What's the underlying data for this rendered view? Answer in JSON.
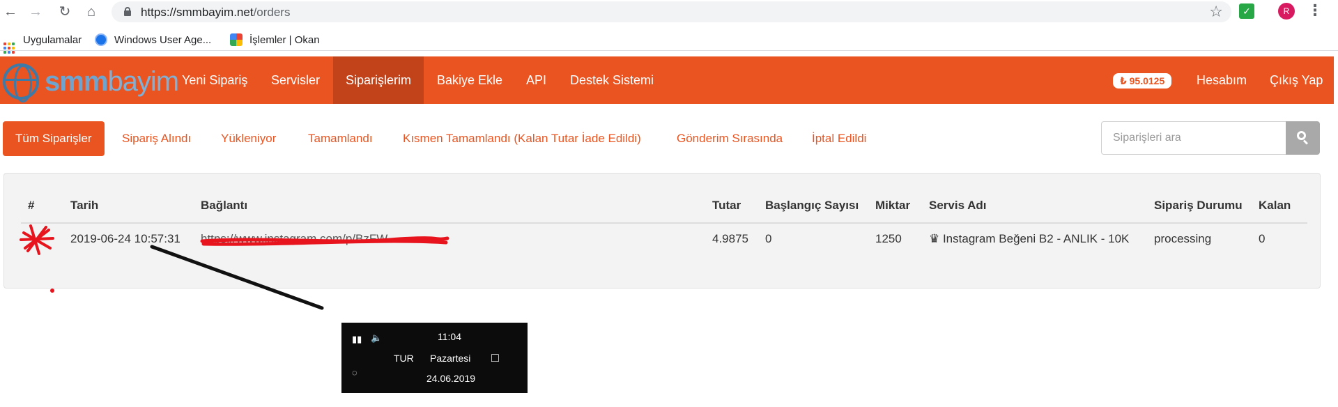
{
  "browser": {
    "url_host": "https://smmbayim.net",
    "url_path": "/orders",
    "profile_initial": "R",
    "icons": [
      "back-arrow-icon",
      "forward-arrow-icon",
      "reload-icon",
      "home-icon",
      "lock-icon",
      "star-icon",
      "extension-icon",
      "profile-icon",
      "menu-icon"
    ]
  },
  "bookmarks": [
    {
      "label": "Uygulamalar"
    },
    {
      "label": "Windows User Age..."
    },
    {
      "label": "İşlemler | Okan"
    }
  ],
  "site": {
    "logo_bold": "smm",
    "logo_thin": "bayim",
    "nav": [
      {
        "label": "Yeni Sipariş"
      },
      {
        "label": "Servisler"
      },
      {
        "label": "Siparişlerim"
      },
      {
        "label": "Bakiye Ekle"
      },
      {
        "label": "API"
      },
      {
        "label": "Destek Sistemi"
      }
    ],
    "balance": "₺ 95.0125",
    "account": "Hesabım",
    "logout": "Çıkış Yap",
    "brand_color": "#ea5420"
  },
  "filters": {
    "tabs": [
      {
        "label": "Tüm Siparişler"
      },
      {
        "label": "Sipariş Alındı"
      },
      {
        "label": "Yükleniyor"
      },
      {
        "label": "Tamamlandı"
      },
      {
        "label": "Kısmen Tamamlandı (Kalan Tutar İade Edildi)"
      },
      {
        "label": "Gönderim Sırasında"
      },
      {
        "label": "İptal Edildi"
      }
    ],
    "search_placeholder": "Siparişleri ara"
  },
  "orders": {
    "headers": [
      "#",
      "Tarih",
      "Bağlantı",
      "Tutar",
      "Başlangıç Sayısı",
      "Miktar",
      "Servis Adı",
      "Sipariş Durumu",
      "Kalan"
    ],
    "rows": [
      {
        "date": "2019-06-24 10:57:31",
        "link": "https://www.instagram.com/p/BzFW...",
        "amount": "4.9875",
        "start_count": "0",
        "quantity": "1250",
        "service": "♛ Instagram Beğeni B2 - ANLIK - 10K",
        "status": "processing",
        "remains": "0"
      }
    ]
  },
  "taskbar": {
    "time": "11:04",
    "lang": "TUR",
    "day": "Pazartesi",
    "date": "24.06.2019"
  }
}
